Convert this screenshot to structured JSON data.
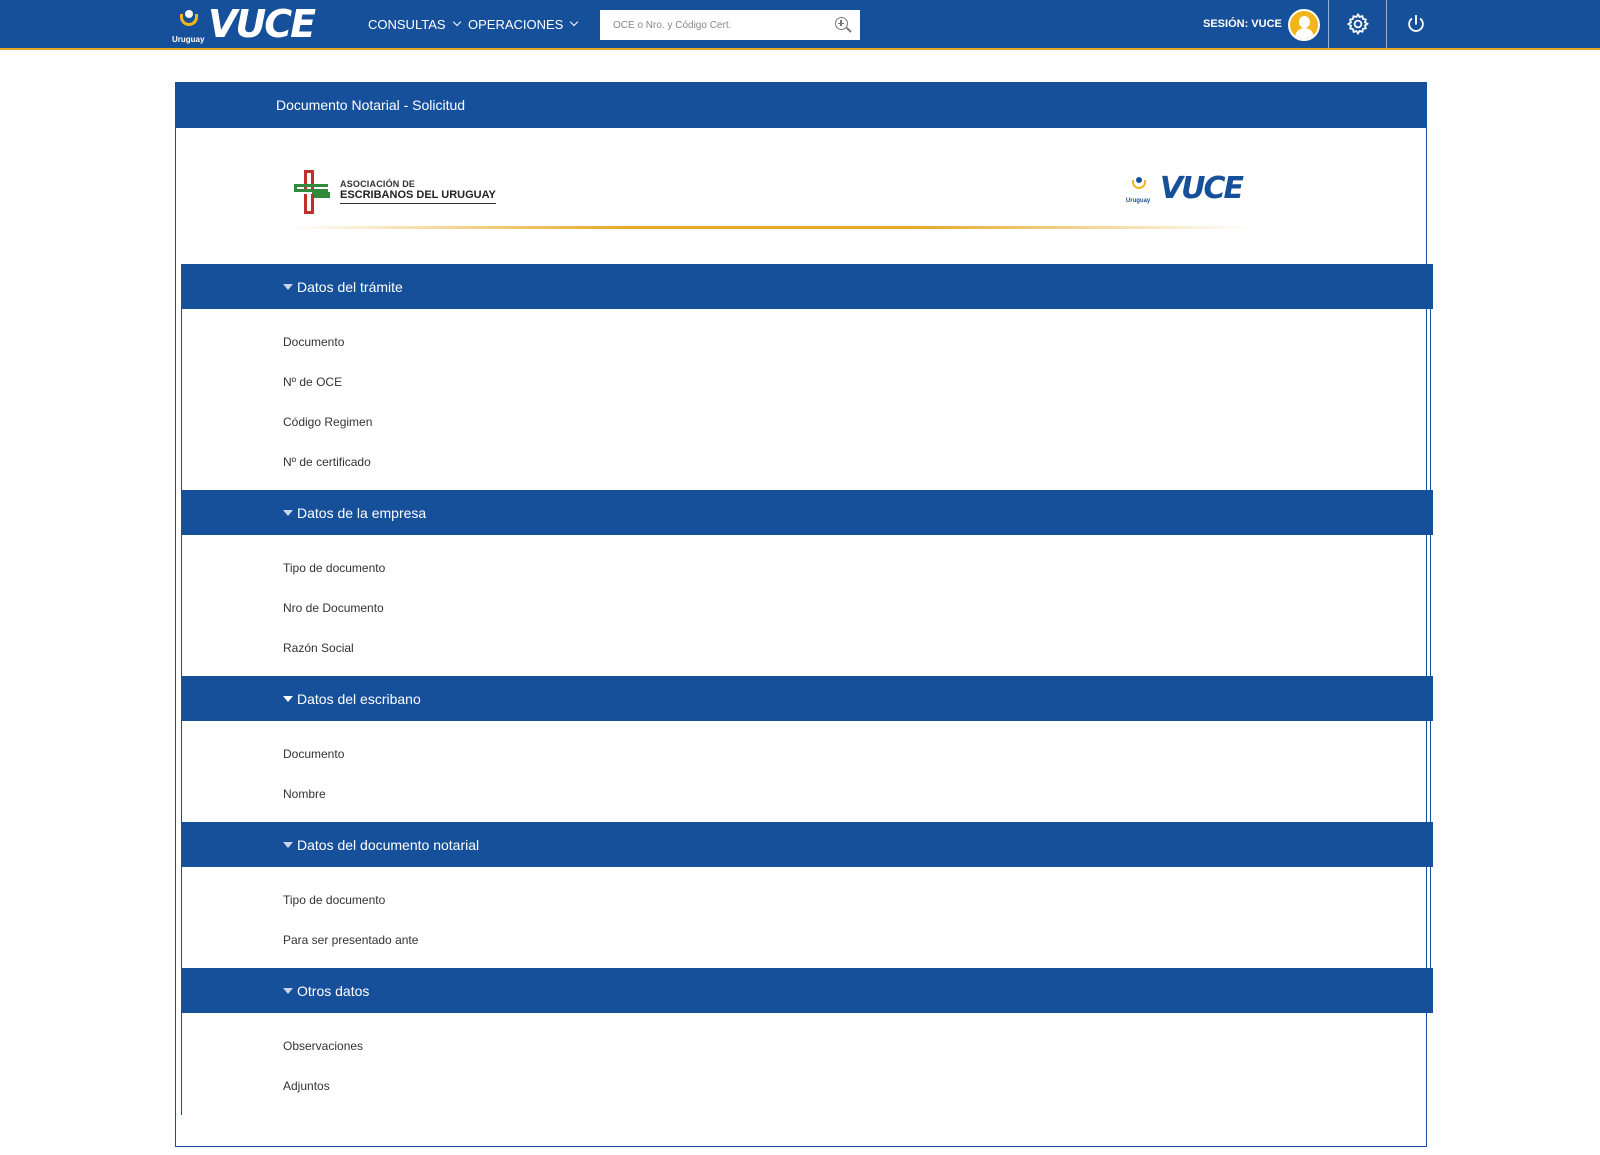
{
  "topbar": {
    "brand_country": "Uruguay",
    "brand_word": "VUCE",
    "nav": [
      {
        "label": "CONSULTAS"
      },
      {
        "label": "OPERACIONES"
      }
    ],
    "search_placeholder": "OCE o Nro. y Código Cert.",
    "session_label": "SESIÓN: VUCE",
    "icons": [
      "search-icon",
      "avatar-icon",
      "gear-icon",
      "power-icon"
    ],
    "colors": {
      "primary": "#17509a",
      "accent": "#f2b61c",
      "border_accent": "#e7a825"
    }
  },
  "card": {
    "title": "Documento Notarial - Solicitud",
    "logo_left_line1": "ASOCIACIÓN DE",
    "logo_left_line2": "ESCRIBANOS DEL URUGUAY",
    "logo_right_country": "Uruguay",
    "logo_right_word": "VUCE"
  },
  "sections": [
    {
      "title": "Datos del trámite",
      "fields": [
        "Documento",
        "Nº de OCE",
        "Código Regimen",
        "Nº de certificado"
      ]
    },
    {
      "title": "Datos de la empresa",
      "fields": [
        "Tipo de documento",
        "Nro de Documento",
        "Razón Social"
      ]
    },
    {
      "title": "Datos del escribano",
      "fields": [
        "Documento",
        "Nombre"
      ]
    },
    {
      "title": "Datos del documento notarial",
      "fields": [
        "Tipo de documento",
        "Para ser presentado ante"
      ]
    },
    {
      "title": "Otros datos",
      "fields": [
        "Observaciones",
        "Adjuntos"
      ]
    }
  ]
}
